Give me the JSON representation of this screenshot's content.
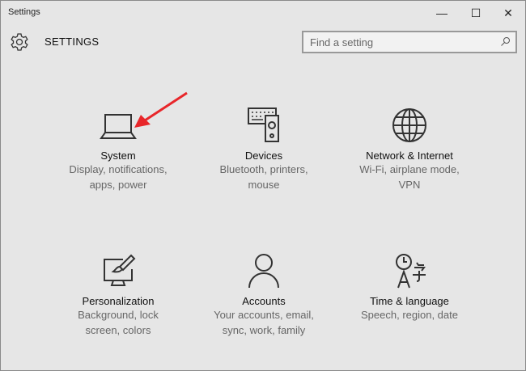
{
  "window": {
    "title": "Settings",
    "minimize": "—",
    "maximize": "☐",
    "close": "✕"
  },
  "header": {
    "title": "SETTINGS",
    "search_placeholder": "Find a setting"
  },
  "tiles": [
    {
      "title": "System",
      "desc1": "Display, notifications,",
      "desc2": "apps, power"
    },
    {
      "title": "Devices",
      "desc1": "Bluetooth, printers,",
      "desc2": "mouse"
    },
    {
      "title": "Network & Internet",
      "desc1": "Wi-Fi, airplane mode,",
      "desc2": "VPN"
    },
    {
      "title": "Personalization",
      "desc1": "Background, lock",
      "desc2": "screen, colors"
    },
    {
      "title": "Accounts",
      "desc1": "Your accounts, email,",
      "desc2": "sync, work, family"
    },
    {
      "title": "Time & language",
      "desc1": "Speech, region, date",
      "desc2": ""
    }
  ],
  "colors": {
    "background": "#e6e6e6",
    "icon": "#333333",
    "annotation_arrow": "#e8262a"
  }
}
